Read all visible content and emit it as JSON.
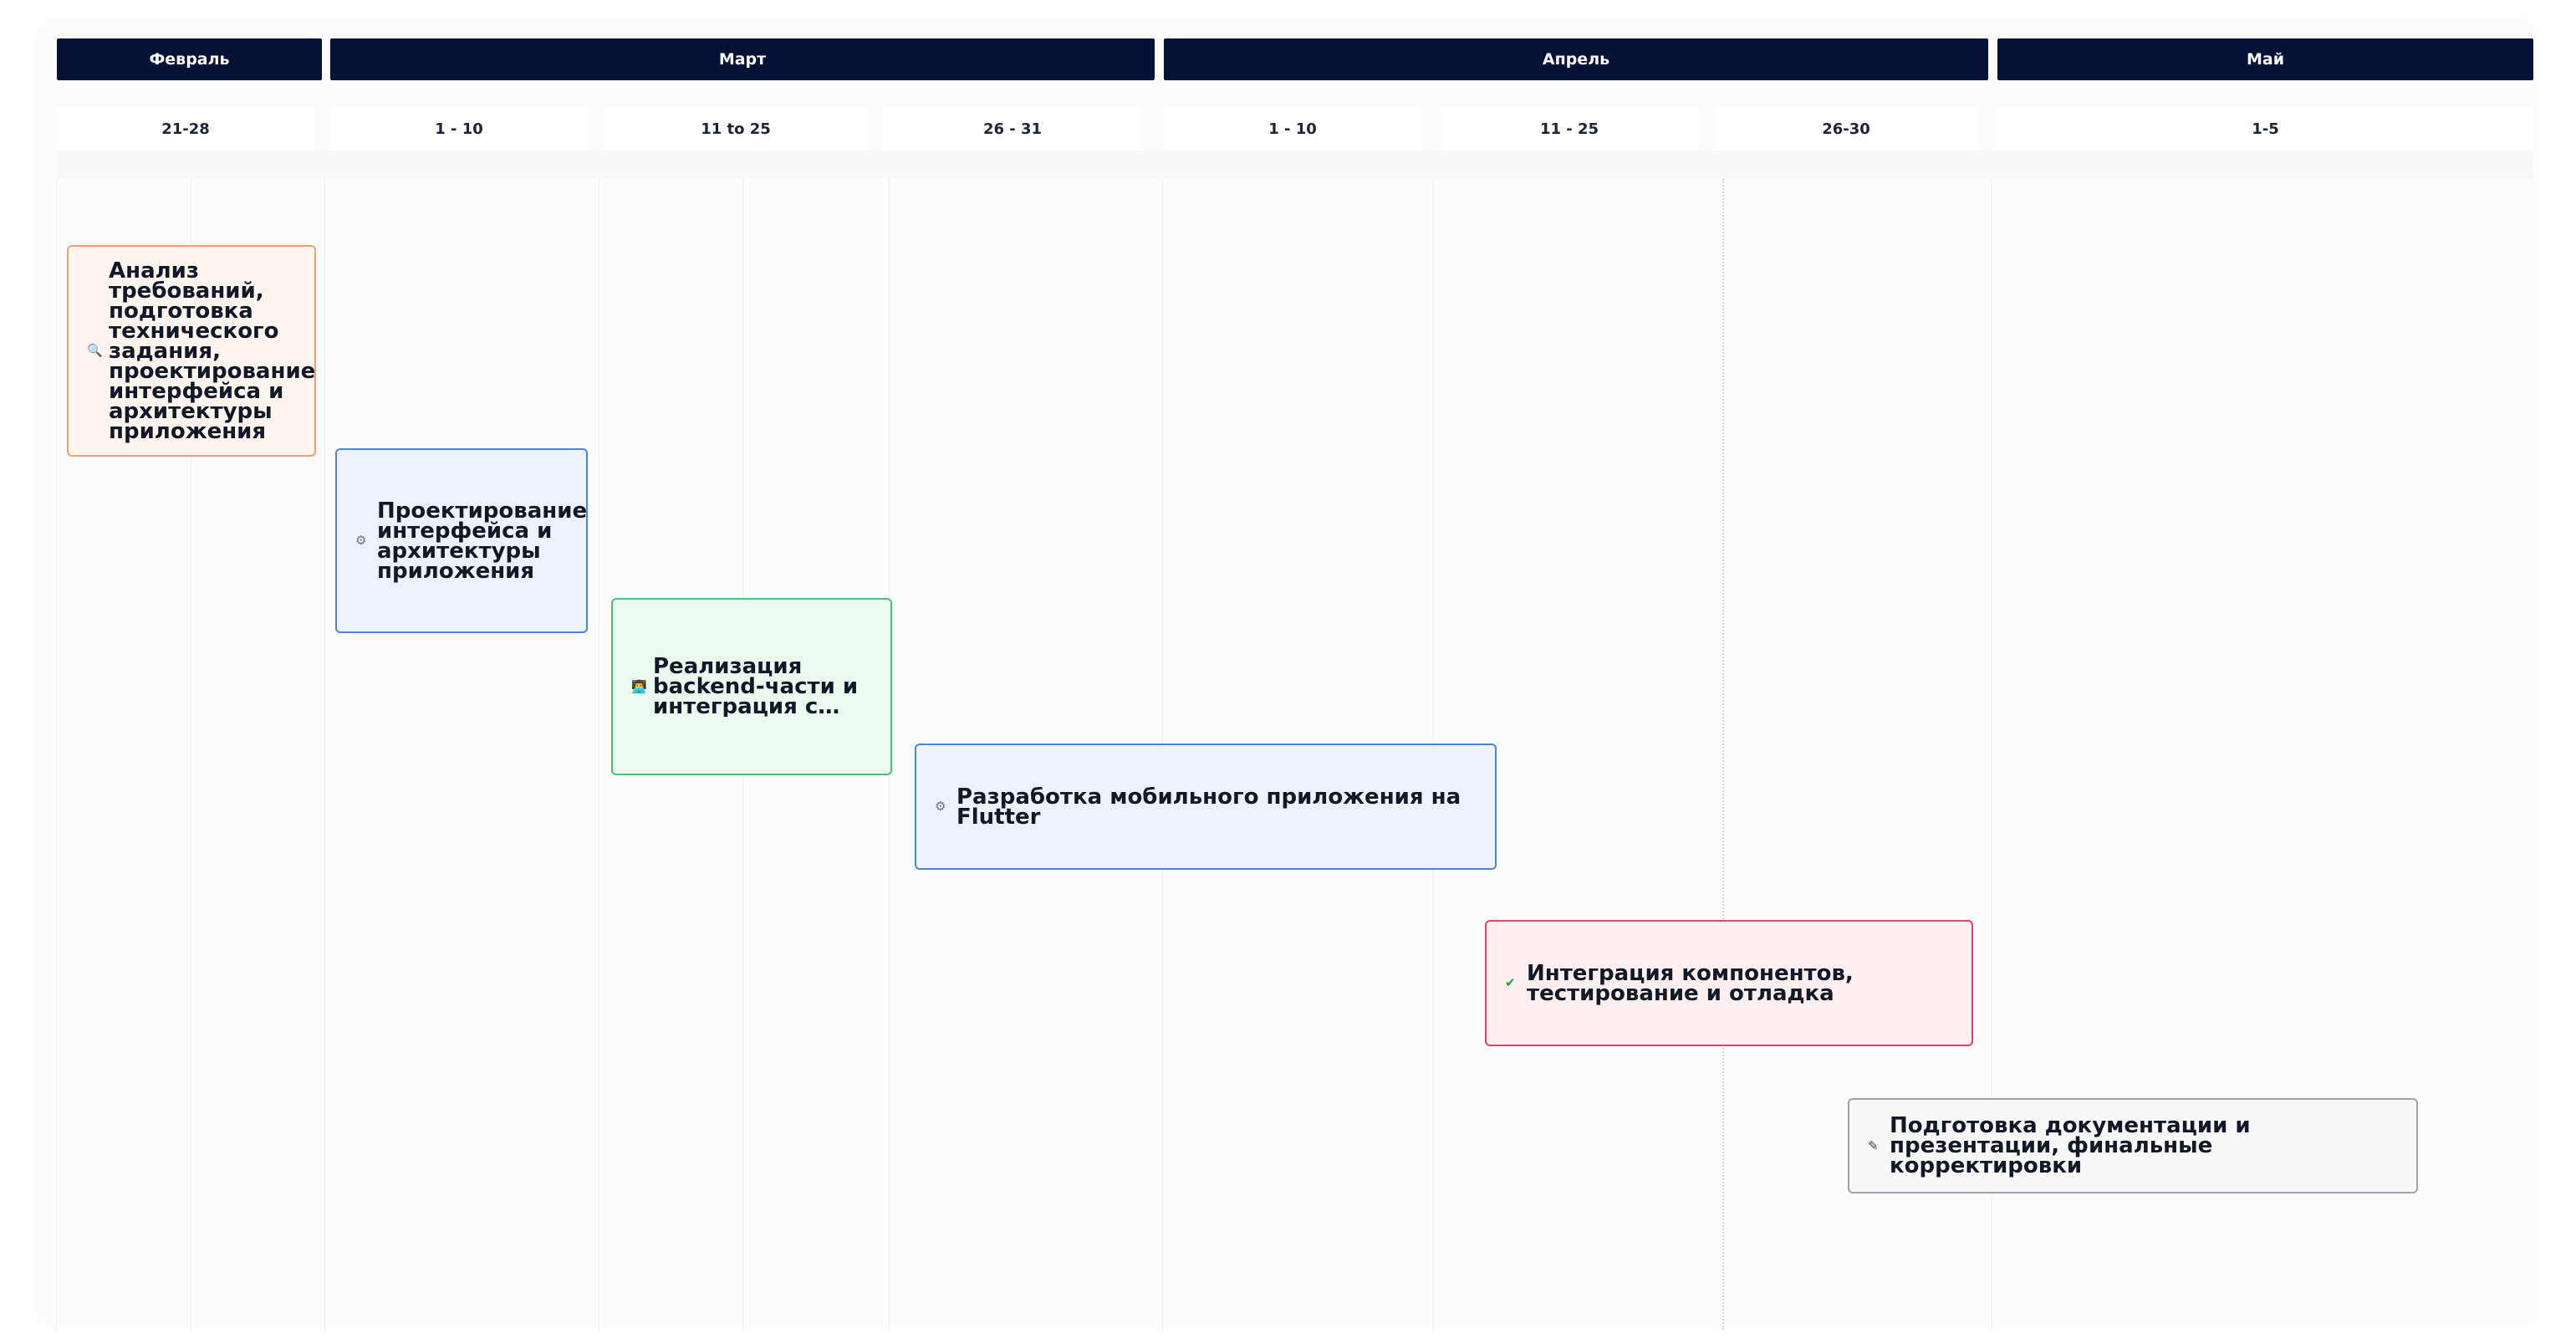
{
  "months": [
    {
      "label": "Февраль"
    },
    {
      "label": "Март"
    },
    {
      "label": "Апрель"
    },
    {
      "label": "Май"
    }
  ],
  "periods": [
    {
      "label": "21-28"
    },
    {
      "label": "1 - 10"
    },
    {
      "label": "11 to 25"
    },
    {
      "label": "26 - 31"
    },
    {
      "label": "1 - 10"
    },
    {
      "label": "11 - 25"
    },
    {
      "label": "26-30"
    },
    {
      "label": "1-5"
    }
  ],
  "tasks": [
    {
      "icon": "magnifier-icon",
      "glyph": "🔍",
      "label": "Анализ требований, подготовка технического задания, проектирование интерфейса и архитектуры приложения",
      "border_color": "#f39f72",
      "fill_color": "#fff5ee"
    },
    {
      "icon": "gear-icon",
      "glyph": "⚙",
      "label": "Проектирование интерфейса и архитектуры приложения",
      "border_color": "#4f83d8",
      "fill_color": "#ecf3ff"
    },
    {
      "icon": "developer-icon",
      "glyph": "👨‍💻",
      "label": "Реализация backend-части и интеграция с Telegram",
      "border_color": "#49c07a",
      "fill_color": "#ebfaef"
    },
    {
      "icon": "gear-icon",
      "glyph": "⚙",
      "label": "Разработка мобильного приложения на Flutter",
      "border_color": "#4f83d8",
      "fill_color": "#ecf3ff"
    },
    {
      "icon": "check-icon",
      "glyph": "✔",
      "label": "Интеграция компонентов, тестирование и отладка",
      "border_color": "#e4426c",
      "fill_color": "#fff0ef"
    },
    {
      "icon": "pencil-icon",
      "glyph": "✎",
      "label": "Подготовка документации и презентации, финальные корректировки",
      "border_color": "#9ea3aa",
      "fill_color": "#f8f8f8"
    }
  ]
}
